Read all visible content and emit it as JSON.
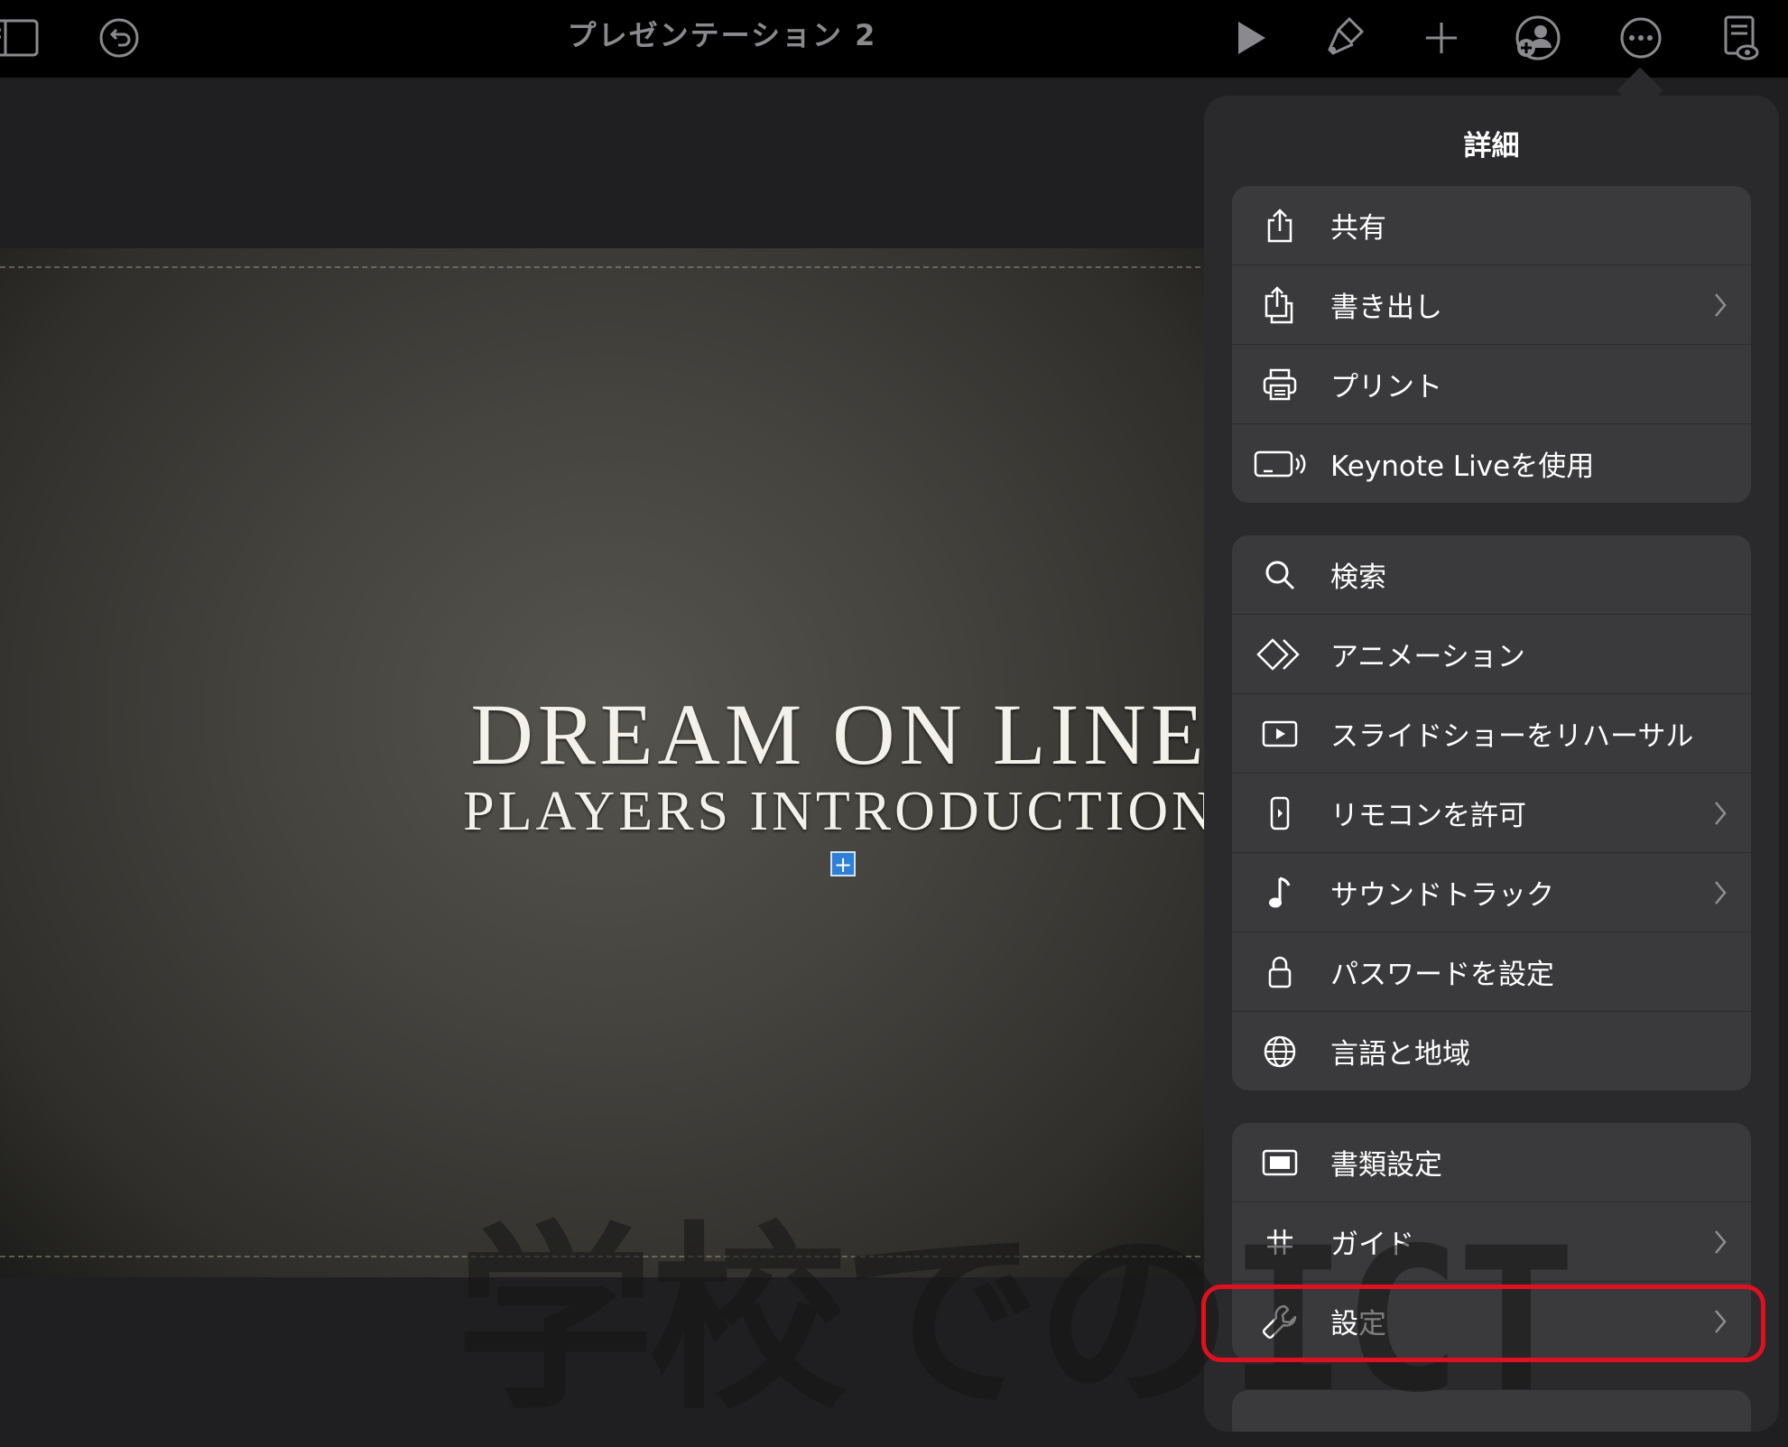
{
  "toolbar": {
    "title": "プレゼンテーション 2",
    "icons": [
      "sidebar-icon",
      "undo-icon",
      "play-icon",
      "format-brush-icon",
      "add-icon",
      "collaborate-icon",
      "more-icon",
      "document-view-icon"
    ]
  },
  "slide": {
    "title": "DREAM ON LINE",
    "subtitle": "PLAYERS INTRODUCTION"
  },
  "popover": {
    "title": "詳細",
    "groups": [
      {
        "items": [
          {
            "label": "共有",
            "icon": "share-icon",
            "chevron": false
          },
          {
            "label": "書き出し",
            "icon": "export-icon",
            "chevron": true
          },
          {
            "label": "プリント",
            "icon": "printer-icon",
            "chevron": false
          },
          {
            "label": "Keynote Liveを使用",
            "icon": "keynote-live-icon",
            "chevron": false
          }
        ]
      },
      {
        "items": [
          {
            "label": "検索",
            "icon": "search-icon",
            "chevron": false
          },
          {
            "label": "アニメーション",
            "icon": "animation-icon",
            "chevron": false
          },
          {
            "label": "スライドショーをリハーサル",
            "icon": "rehearse-icon",
            "chevron": false
          },
          {
            "label": "リモコンを許可",
            "icon": "remote-icon",
            "chevron": true
          },
          {
            "label": "サウンドトラック",
            "icon": "music-note-icon",
            "chevron": true
          },
          {
            "label": "パスワードを設定",
            "icon": "lock-icon",
            "chevron": false
          },
          {
            "label": "言語と地域",
            "icon": "globe-icon",
            "chevron": false
          }
        ]
      },
      {
        "items": [
          {
            "label": "書類設定",
            "icon": "document-setup-icon",
            "chevron": false
          },
          {
            "label": "ガイド",
            "icon": "grid-icon",
            "chevron": true
          },
          {
            "label": "設定",
            "icon": "wrench-icon",
            "chevron": true
          }
        ]
      }
    ]
  },
  "watermark": "学校でのICT",
  "colors": {
    "highlight": "#e01020",
    "accent": "#2f7fd8"
  }
}
